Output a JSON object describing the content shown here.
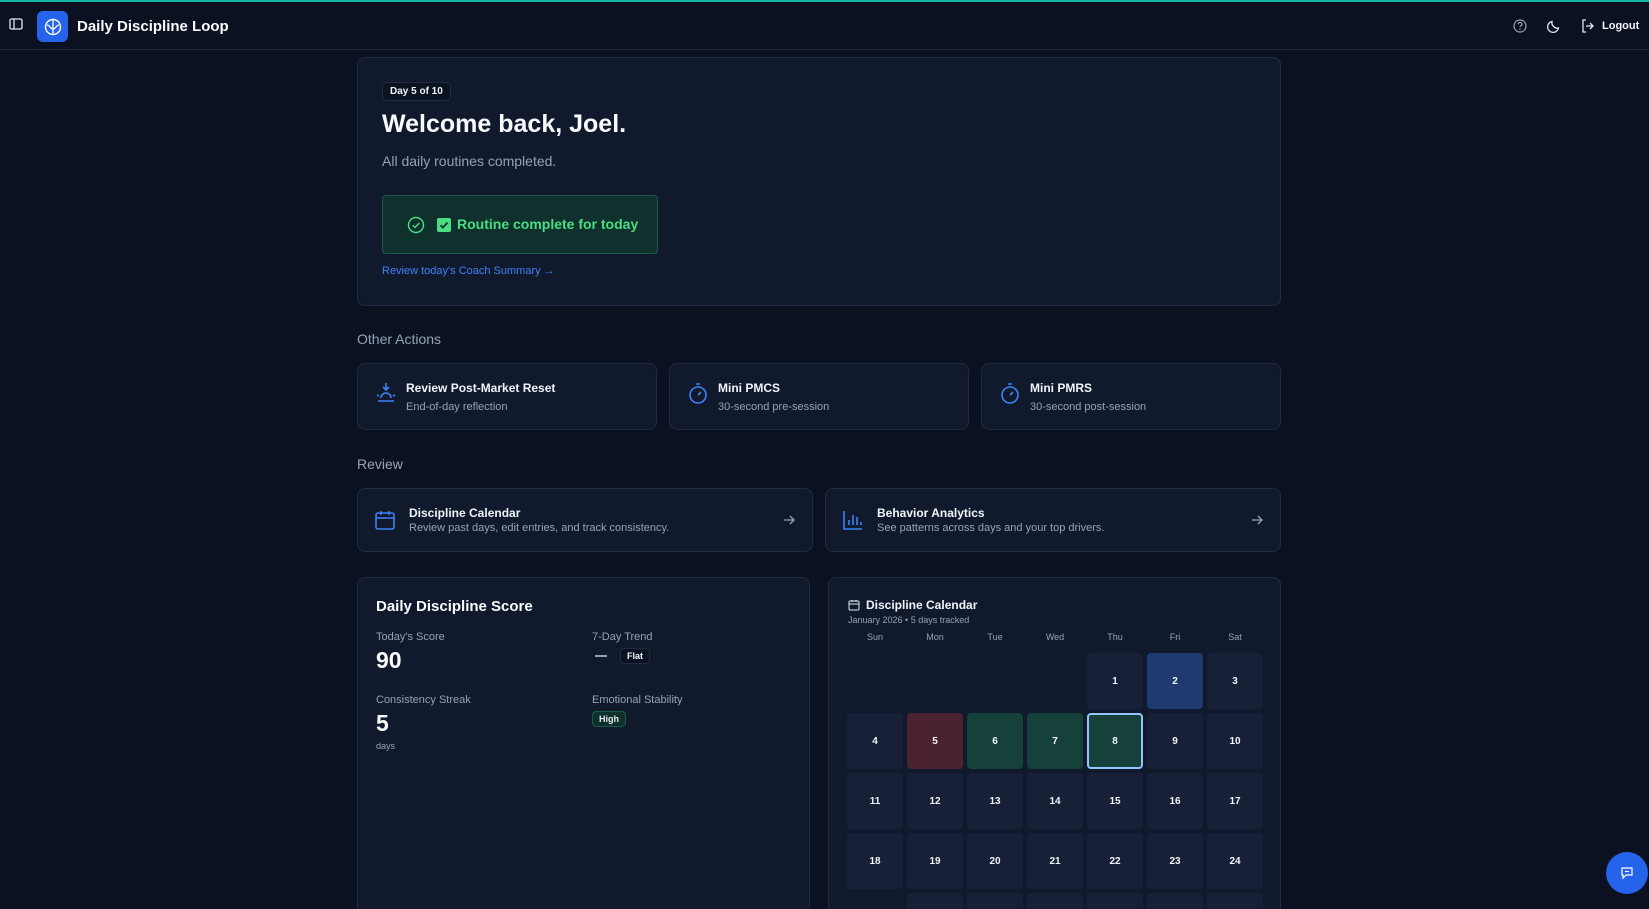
{
  "header": {
    "app_title": "Daily Discipline Loop",
    "logout_label": "Logout"
  },
  "hero": {
    "day_badge": "Day 5 of 10",
    "welcome": "Welcome back, Joel.",
    "subtitle": "All daily routines completed.",
    "routine_status": "Routine complete for today",
    "coach_link": "Review today's Coach Summary →"
  },
  "other_actions": {
    "title": "Other Actions",
    "items": [
      {
        "title": "Review Post-Market Reset",
        "desc": "End-of-day reflection"
      },
      {
        "title": "Mini PMCS",
        "desc": "30-second pre-session"
      },
      {
        "title": "Mini PMRS",
        "desc": "30-second post-session"
      }
    ]
  },
  "review": {
    "title": "Review",
    "items": [
      {
        "title": "Discipline Calendar",
        "desc": "Review past days, edit entries, and track consistency."
      },
      {
        "title": "Behavior Analytics",
        "desc": "See patterns across days and your top drivers."
      }
    ]
  },
  "score": {
    "title": "Daily Discipline Score",
    "todays_score_label": "Today's Score",
    "todays_score": "90",
    "trend_label": "7-Day Trend",
    "trend_value": "Flat",
    "streak_label": "Consistency Streak",
    "streak_value": "5",
    "streak_unit": "days",
    "stability_label": "Emotional Stability",
    "stability_value": "High"
  },
  "calendar": {
    "title": "Discipline Calendar",
    "subtitle": "January 2026 • 5 days tracked",
    "weekdays": [
      "Sun",
      "Mon",
      "Tue",
      "Wed",
      "Thu",
      "Fri",
      "Sat"
    ],
    "first_weekday_index": 4,
    "days_shown": 24,
    "day_states": {
      "2": "blue",
      "5": "red",
      "6": "green",
      "7": "green",
      "8": "today"
    },
    "colors": {
      "blue": "#1e3a6e",
      "red": "#4a2230",
      "green": "#16403a",
      "today_border": "#93c5fd",
      "default": "#172036"
    }
  }
}
